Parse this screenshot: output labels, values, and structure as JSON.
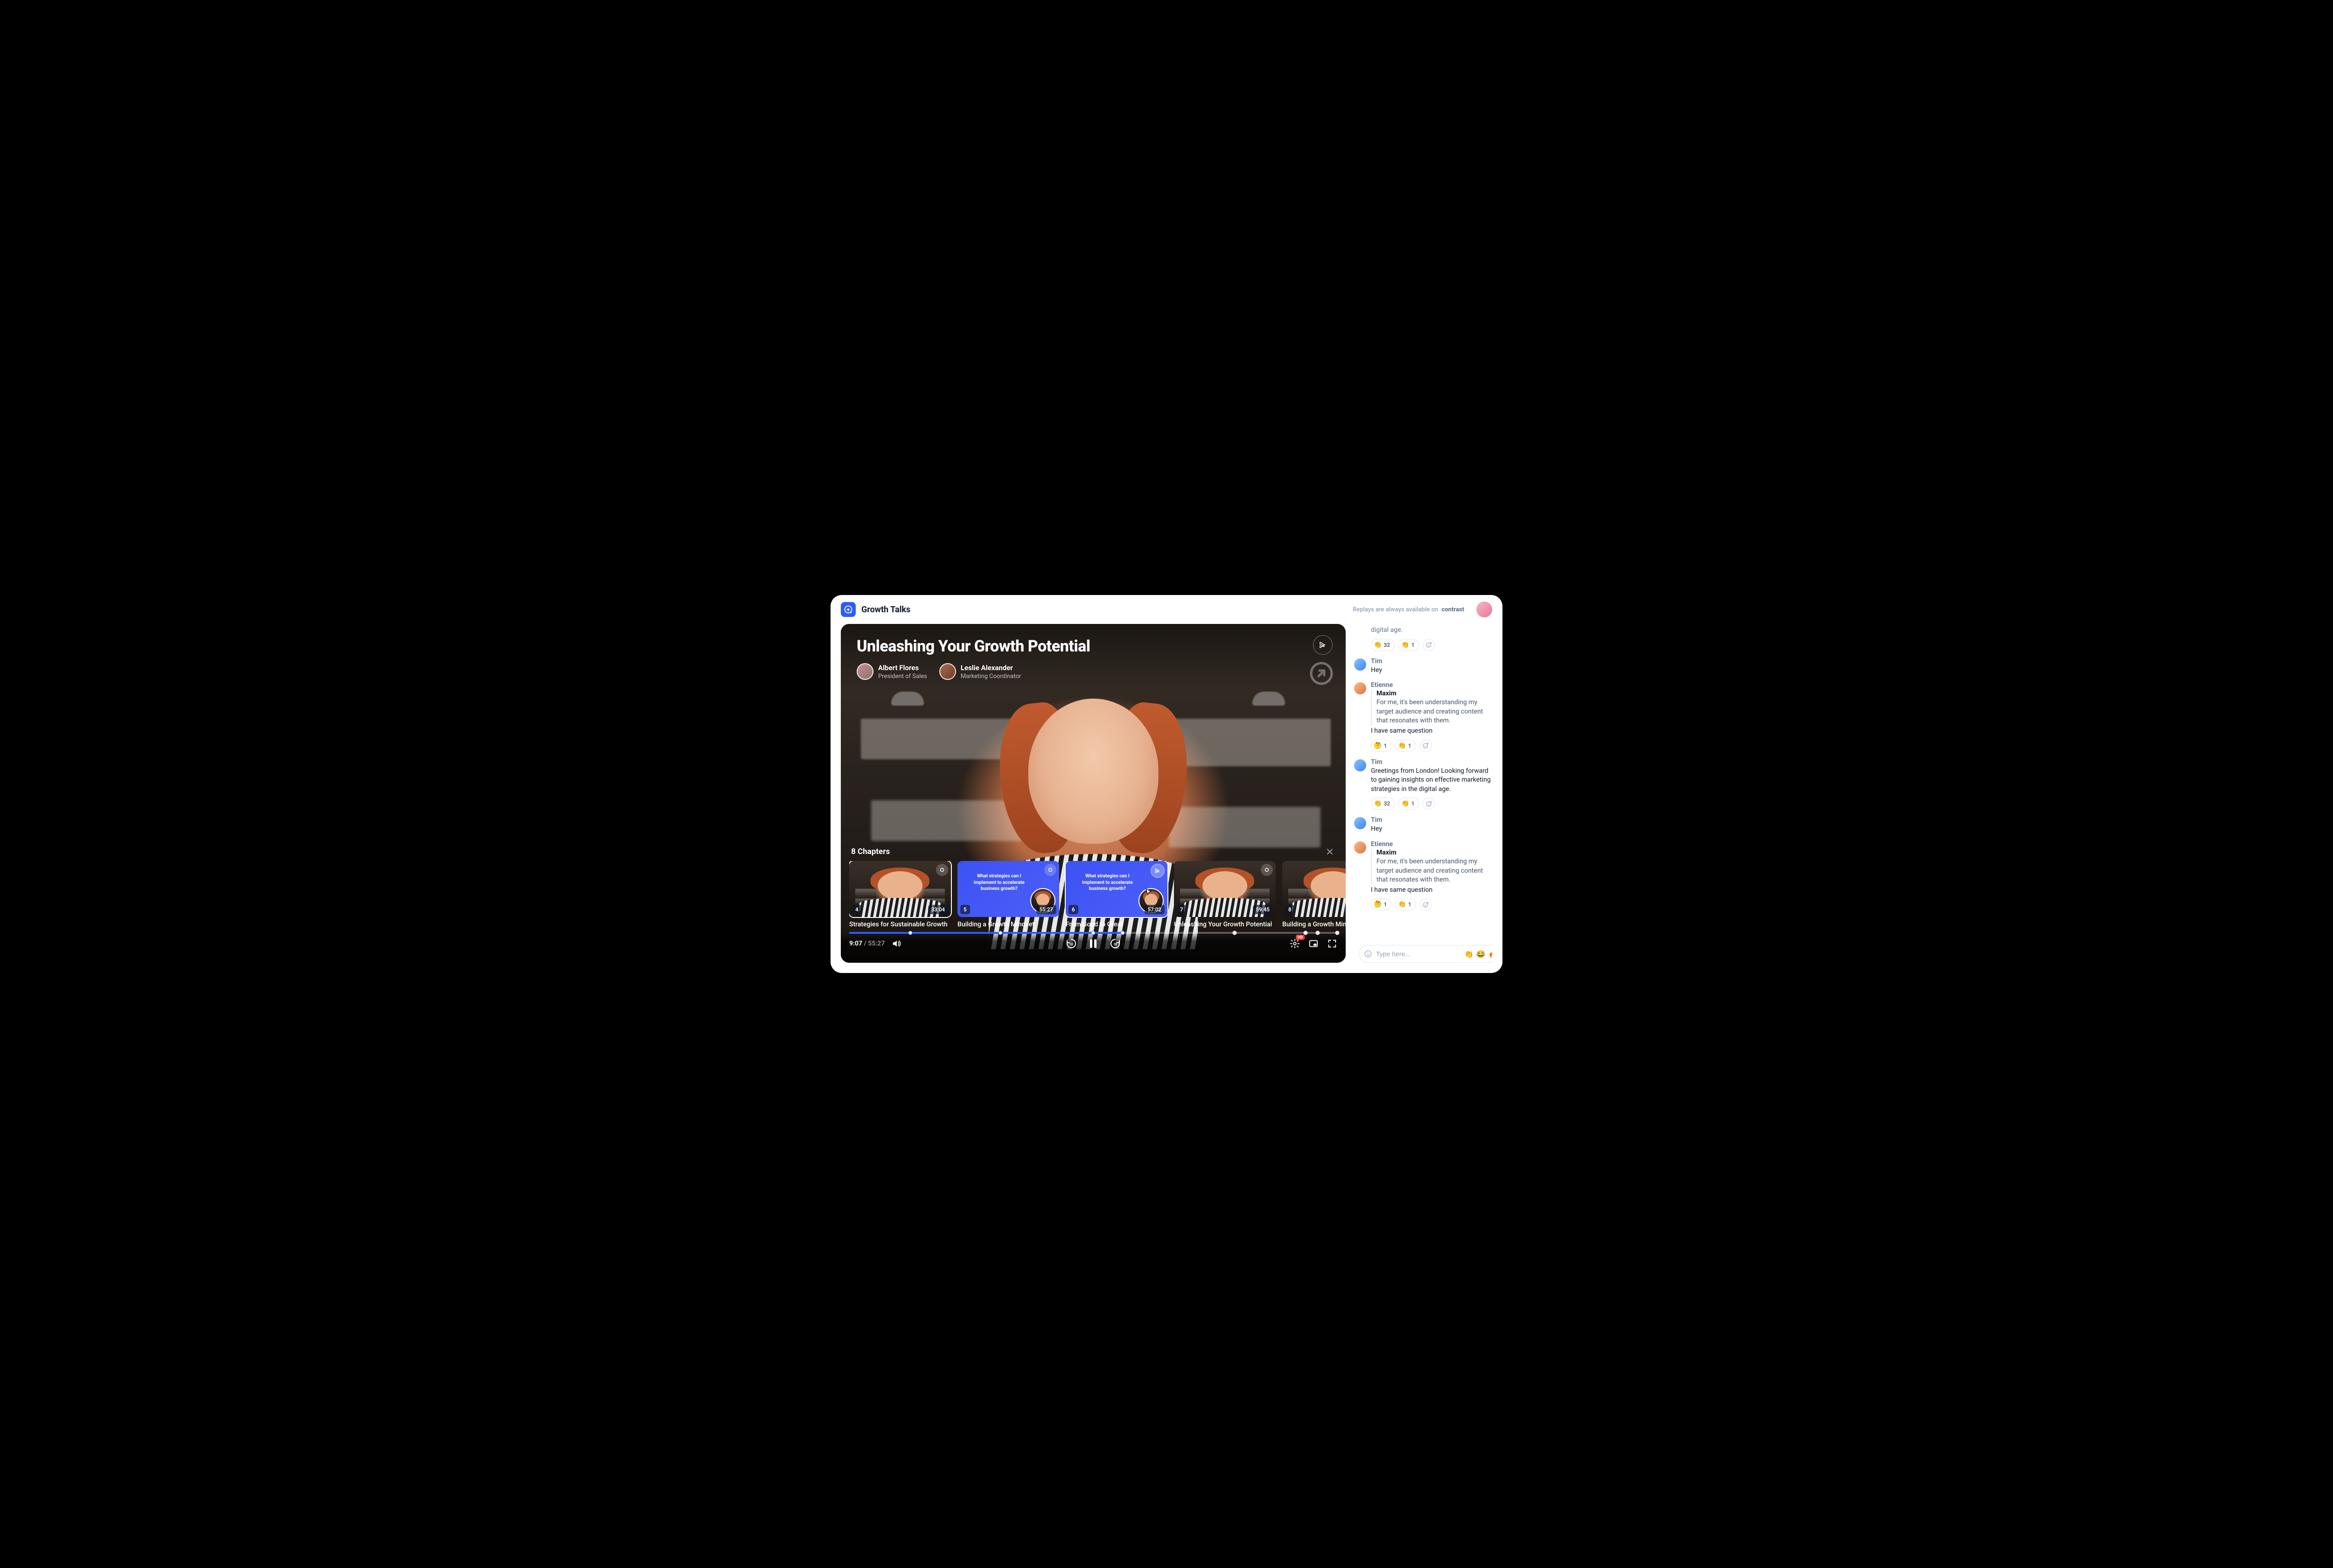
{
  "header": {
    "app_title": "Growth Talks",
    "replay_note": "Replays are always available on",
    "replay_brand": "contrast"
  },
  "video": {
    "title": "Unleashing Your Growth Potential",
    "hosts": [
      {
        "name": "Albert Flores",
        "role": "President of Sales"
      },
      {
        "name": "Leslie Alexander",
        "role": "Marketing Coordinator"
      }
    ],
    "chapters_heading": "8 Chapters",
    "chapters": [
      {
        "num": "4",
        "time": "33:04",
        "label": "Strategies for Sustainable Growth",
        "kind": "person",
        "active": true
      },
      {
        "num": "5",
        "time": "55:27",
        "label": "Building a Growth Mindset",
        "kind": "slide",
        "slide_text": "What strategies can I implement to accelerate business growth?"
      },
      {
        "num": "6",
        "time": "57:02",
        "label": "From Good to Great",
        "kind": "slide",
        "slide_text": "What strategies can I implement to accelerate business growth?",
        "active": true,
        "share": true
      },
      {
        "num": "7",
        "time": "59:45",
        "label": "Unleashing Your Growth Potential",
        "kind": "person"
      },
      {
        "num": "8",
        "time": "",
        "label": "Building a Growth Mindset",
        "kind": "person"
      }
    ],
    "time_current": "9:07",
    "time_duration": "55:27",
    "hd_label": "HD",
    "seek_markers_pct": [
      12.5,
      31,
      50,
      56,
      79,
      93.5,
      96,
      100
    ]
  },
  "chat": {
    "messages": [
      {
        "name": "",
        "trailing_text": "digital age.",
        "avatar": "none",
        "reactions": [
          {
            "emoji": "👏",
            "count": "32"
          },
          {
            "emoji": "👏",
            "count": "1"
          }
        ],
        "add_react": true
      },
      {
        "name": "Tim",
        "text": "Hey",
        "avatar": "blue"
      },
      {
        "name": "Etienne",
        "avatar": "orange",
        "reply": {
          "name": "Maxim",
          "text": "For me, it's been understanding my target audience and creating content that resonates with them."
        },
        "text": "I have same question",
        "reactions": [
          {
            "emoji": "🤔",
            "count": "1"
          },
          {
            "emoji": "👏",
            "count": "1"
          }
        ],
        "add_react": true
      },
      {
        "name": "Tim",
        "avatar": "blue",
        "text": "Greetings from London! Looking forward to gaining insights on effective marketing strategies in the digital age.",
        "reactions": [
          {
            "emoji": "👏",
            "count": "32"
          },
          {
            "emoji": "👏",
            "count": "1"
          }
        ],
        "add_react": true
      },
      {
        "name": "Tim",
        "text": "Hey",
        "avatar": "blue"
      },
      {
        "name": "Etienne",
        "avatar": "orange",
        "reply": {
          "name": "Maxim",
          "text": "For me, it's been understanding my target audience and creating content that resonates with them."
        },
        "text": "I have same question",
        "reactions": [
          {
            "emoji": "🤔",
            "count": "1"
          },
          {
            "emoji": "👏",
            "count": "1"
          }
        ],
        "add_react": true
      }
    ],
    "input_placeholder": "Type here...",
    "quick_reacts": [
      "👏",
      "😂",
      "🔥"
    ]
  }
}
